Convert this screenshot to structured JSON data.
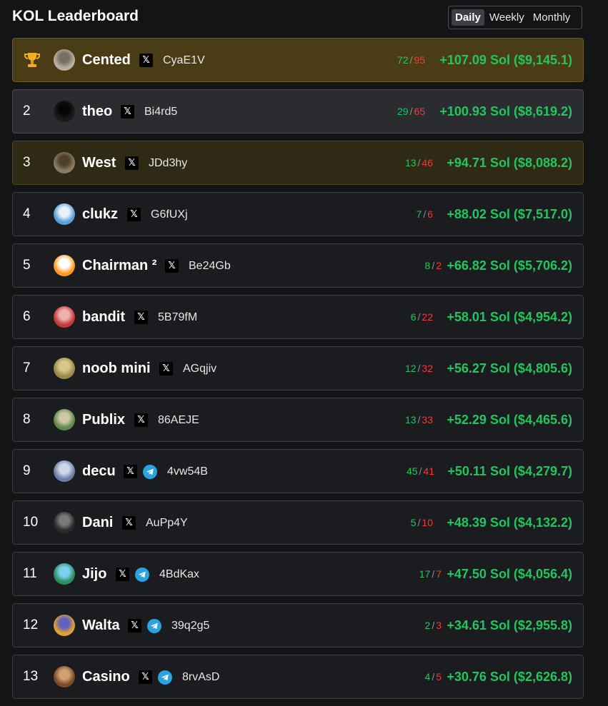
{
  "header": {
    "title": "KOL Leaderboard",
    "periods": [
      "Daily",
      "Weekly",
      "Monthly"
    ],
    "active_period": "Daily"
  },
  "colors": {
    "win": "#22c55e",
    "loss": "#ef3b3b",
    "pnl": "#22c55e",
    "gold_row": "#4a3d16"
  },
  "rows": [
    {
      "rank": "1",
      "rank_icon": "trophy-icon",
      "name": "Cented",
      "wallet": "CyaE1V",
      "telegram": false,
      "wins": "72",
      "losses": "95",
      "pnl": "+107.09 Sol ($9,145.1)"
    },
    {
      "rank": "2",
      "name": "theo",
      "wallet": "Bi4rd5",
      "telegram": false,
      "wins": "29",
      "losses": "65",
      "pnl": "+100.93 Sol ($8,619.2)"
    },
    {
      "rank": "3",
      "name": "West",
      "wallet": "JDd3hy",
      "telegram": false,
      "wins": "13",
      "losses": "46",
      "pnl": "+94.71 Sol ($8,088.2)"
    },
    {
      "rank": "4",
      "name": "clukz",
      "wallet": "G6fUXj",
      "telegram": false,
      "wins": "7",
      "losses": "6",
      "pnl": "+88.02 Sol ($7,517.0)"
    },
    {
      "rank": "5",
      "name": "Chairman ²",
      "wallet": "Be24Gb",
      "telegram": false,
      "wins": "8",
      "losses": "2",
      "pnl": "+66.82 Sol ($5,706.2)"
    },
    {
      "rank": "6",
      "name": "bandit",
      "wallet": "5B79fM",
      "telegram": false,
      "wins": "6",
      "losses": "22",
      "pnl": "+58.01 Sol ($4,954.2)"
    },
    {
      "rank": "7",
      "name": "noob mini",
      "wallet": "AGqjiv",
      "telegram": false,
      "wins": "12",
      "losses": "32",
      "pnl": "+56.27 Sol ($4,805.6)"
    },
    {
      "rank": "8",
      "name": "Publix",
      "wallet": "86AEJE",
      "telegram": false,
      "wins": "13",
      "losses": "33",
      "pnl": "+52.29 Sol ($4,465.6)"
    },
    {
      "rank": "9",
      "name": "decu",
      "wallet": "4vw54B",
      "telegram": true,
      "wins": "45",
      "losses": "41",
      "pnl": "+50.11 Sol ($4,279.7)"
    },
    {
      "rank": "10",
      "name": "Dani",
      "wallet": "AuPp4Y",
      "telegram": false,
      "wins": "5",
      "losses": "10",
      "pnl": "+48.39 Sol ($4,132.2)"
    },
    {
      "rank": "11",
      "name": "Jijo",
      "wallet": "4BdKax",
      "telegram": true,
      "wins": "17",
      "losses": "7",
      "pnl": "+47.50 Sol ($4,056.4)"
    },
    {
      "rank": "12",
      "name": "Walta",
      "wallet": "39q2g5",
      "telegram": true,
      "wins": "2",
      "losses": "3",
      "pnl": "+34.61 Sol ($2,955.8)"
    },
    {
      "rank": "13",
      "name": "Casino",
      "wallet": "8rvAsD",
      "telegram": true,
      "wins": "4",
      "losses": "5",
      "pnl": "+30.76 Sol ($2,626.8)"
    }
  ]
}
